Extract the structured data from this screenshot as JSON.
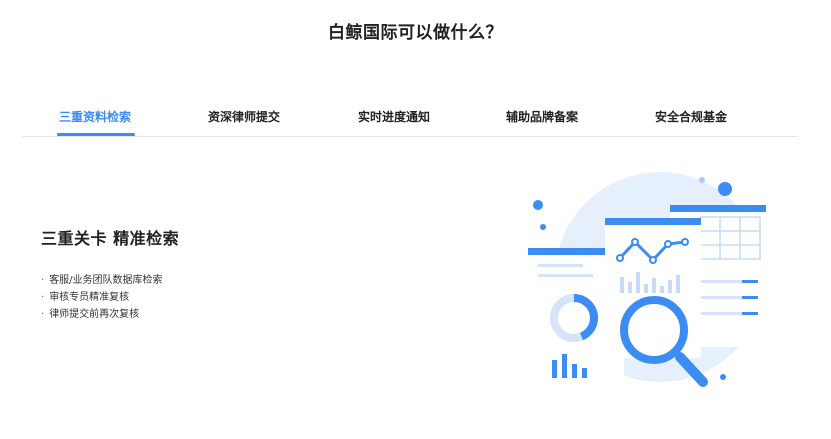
{
  "page": {
    "title": "白鲸国际可以做什么？"
  },
  "tabs": [
    {
      "label": "三重资料检索",
      "active": true
    },
    {
      "label": "资深律师提交",
      "active": false
    },
    {
      "label": "实时进度通知",
      "active": false
    },
    {
      "label": "辅助品牌备案",
      "active": false
    },
    {
      "label": "安全合规基金",
      "active": false
    }
  ],
  "content": {
    "title": "三重关卡 精准检索",
    "bullet_marker": "·",
    "bullets": [
      "客服/业务团队数据库检索",
      "审核专员精准复核",
      "律师提交前再次复核"
    ]
  },
  "colors": {
    "accent": "#3b8cf3",
    "text": "#222222",
    "divider": "#e3e6ec",
    "illustration_bg": "#e6effc"
  },
  "icons": {
    "illustration": "data-analysis-magnifier-illustration"
  }
}
